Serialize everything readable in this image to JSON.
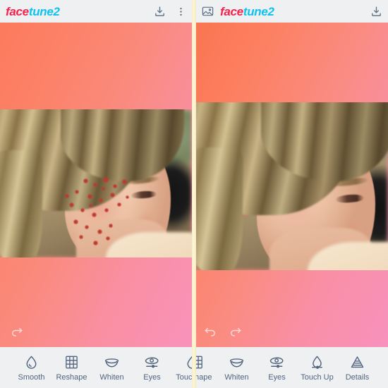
{
  "app": {
    "name_part_1": "face",
    "name_part_2": "tune2",
    "brand_red": "#f5224b",
    "brand_cyan": "#0dc3f2",
    "toolbar_icon_color": "#52657e"
  },
  "panels": [
    {
      "id": "before",
      "header": {
        "has_gallery_icon": false,
        "gallery_icon": "image-icon",
        "download_icon": "download-icon",
        "overflow_icon": "more-vertical-icon"
      },
      "history": {
        "undo_icon": "undo-icon",
        "redo_icon": "redo-icon",
        "undo_visible": false,
        "redo_visible": true
      },
      "toolbar": [
        {
          "icon": "droplet-icon",
          "label": "Smooth"
        },
        {
          "icon": "grid-icon",
          "label": "Reshape"
        },
        {
          "icon": "smile-icon",
          "label": "Whiten"
        },
        {
          "icon": "eye-icon",
          "label": "Eyes"
        },
        {
          "icon": "droplet-icon",
          "label": "Touch Up"
        }
      ]
    },
    {
      "id": "after",
      "header": {
        "has_gallery_icon": true,
        "gallery_icon": "image-icon",
        "download_icon": "download-icon",
        "overflow_icon": null
      },
      "history": {
        "undo_icon": "undo-icon",
        "redo_icon": "redo-icon",
        "undo_visible": true,
        "redo_visible": true
      },
      "toolbar": [
        {
          "icon": "grid-icon",
          "label": "Reshape"
        },
        {
          "icon": "smile-icon",
          "label": "Whiten"
        },
        {
          "icon": "eye-icon",
          "label": "Eyes"
        },
        {
          "icon": "droplet-icon",
          "label": "Touch Up"
        },
        {
          "icon": "triangle-icon",
          "label": "Details"
        }
      ]
    }
  ],
  "toolbar_left": {
    "items": [
      {
        "label": "Smooth"
      },
      {
        "label": "Reshape"
      },
      {
        "label": "Whiten"
      },
      {
        "label": "Eyes"
      },
      {
        "label": "Touch Up"
      }
    ]
  },
  "toolbar_right": {
    "items": [
      {
        "label": "Reshape"
      },
      {
        "label": "Whiten"
      },
      {
        "label": "Eyes"
      },
      {
        "label": "Touch Up"
      },
      {
        "label": "Details"
      }
    ]
  },
  "photo": {
    "subject": "young woman profile with blonde hair",
    "before_has_acne": true,
    "after_has_acne": false
  }
}
